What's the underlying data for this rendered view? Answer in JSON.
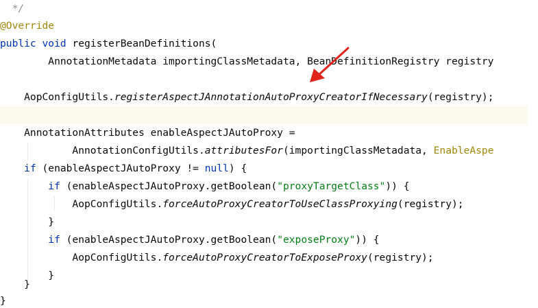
{
  "code": {
    "line1": {
      "comment": "*/"
    },
    "line2": {
      "annotation": "@Override"
    },
    "line3": {
      "kw_public": "public",
      "kw_void": "void",
      "text": " registerBeanDefinitions("
    },
    "line4": {
      "text": "        AnnotationMetadata importingClassMetadata, BeanDefinitionRegistry registry"
    },
    "line5": {
      "prefix": "    AopConfigUtils.",
      "method": "registerAspectJAnnotationAutoProxyCreatorIfNecessary",
      "suffix": "(registry);"
    },
    "line6": {
      "text": ""
    },
    "line7": {
      "text": "    AnnotationAttributes enableAspectJAutoProxy ="
    },
    "line8": {
      "prefix": "            AnnotationConfigUtils.",
      "method": "attributesFor",
      "middle": "(importingClassMetadata, ",
      "annotation_class": "EnableAspe"
    },
    "line9": {
      "indent": "    ",
      "kw_if": "if",
      "open": " (enableAspectJAutoProxy != ",
      "kw_null": "null",
      "close": ") {"
    },
    "line10": {
      "indent": "        ",
      "kw_if": "if",
      "open": " (enableAspectJAutoProxy.getBoolean(",
      "string": "\"proxyTargetClass\"",
      "close": ")) {"
    },
    "line11": {
      "prefix": "            AopConfigUtils.",
      "method": "forceAutoProxyCreatorToUseClassProxying",
      "suffix": "(registry);"
    },
    "line12": {
      "text": "        }"
    },
    "line13": {
      "indent": "        ",
      "kw_if": "if",
      "open": " (enableAspectJAutoProxy.getBoolean(",
      "string": "\"exposeProxy\"",
      "close": ")) {"
    },
    "line14": {
      "prefix": "            AopConfigUtils.",
      "method": "forceAutoProxyCreatorToExposeProxy",
      "suffix": "(registry);"
    },
    "line15": {
      "text": "        }"
    },
    "line16": {
      "text": "    }"
    },
    "line17": {
      "text": "}"
    }
  },
  "colors": {
    "keyword": "#0033b3",
    "annotation": "#9e880d",
    "string": "#067d17",
    "comment": "#8c8c8c",
    "current_line": "#fcfaed",
    "arrow": "#e0231b"
  }
}
